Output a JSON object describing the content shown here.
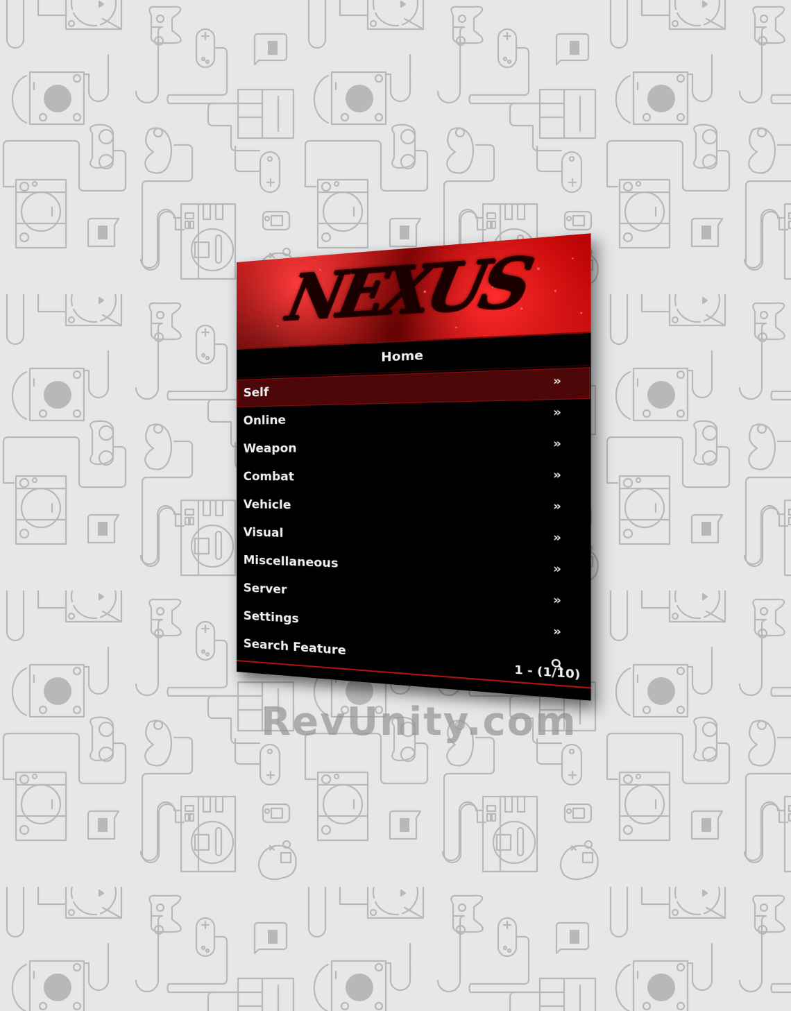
{
  "background": {
    "color": "#e6e7e9",
    "pattern_stroke": "#b8b8b8",
    "pattern_icons": [
      "gamecube-icon",
      "playstation-icon",
      "dreamcast-icon",
      "snes-icon",
      "n64-icon",
      "gamecube-controller-icon",
      "snes-controller-icon",
      "genesis-controller-icon",
      "playstation-controller-icon",
      "dreamcast-controller-icon",
      "vmu-icon",
      "discord-bubble-icon"
    ]
  },
  "watermark": {
    "text": "RevUnity.com"
  },
  "menu": {
    "logo_text": "NEXUS",
    "title": "Home",
    "accent_color": "#b01212",
    "selected_color": "#4d0709",
    "items": [
      {
        "label": "Self",
        "icon": "chevron-double-right-icon",
        "glyph": "»",
        "selected": true
      },
      {
        "label": "Online",
        "icon": "chevron-double-right-icon",
        "glyph": "»",
        "selected": false
      },
      {
        "label": "Weapon",
        "icon": "chevron-double-right-icon",
        "glyph": "»",
        "selected": false
      },
      {
        "label": "Combat",
        "icon": "chevron-double-right-icon",
        "glyph": "»",
        "selected": false
      },
      {
        "label": "Vehicle",
        "icon": "chevron-double-right-icon",
        "glyph": "»",
        "selected": false
      },
      {
        "label": "Visual",
        "icon": "chevron-double-right-icon",
        "glyph": "»",
        "selected": false
      },
      {
        "label": "Miscellaneous",
        "icon": "chevron-double-right-icon",
        "glyph": "»",
        "selected": false
      },
      {
        "label": "Server",
        "icon": "chevron-double-right-icon",
        "glyph": "»",
        "selected": false
      },
      {
        "label": "Settings",
        "icon": "chevron-double-right-icon",
        "glyph": "»",
        "selected": false
      },
      {
        "label": "Search Feature",
        "icon": "search-icon",
        "glyph": "",
        "selected": false
      }
    ],
    "footer": {
      "page_indicator": "1 - (1/10)"
    }
  }
}
